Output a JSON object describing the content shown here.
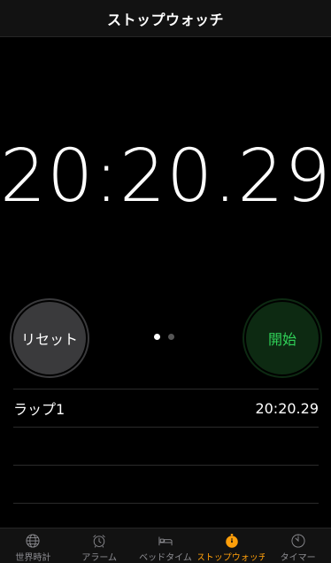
{
  "nav": {
    "title": "ストップウォッチ"
  },
  "timer": {
    "display": "20:20.29"
  },
  "buttons": {
    "reset_label": "リセット",
    "start_label": "開始"
  },
  "page_dots": {
    "count": 2,
    "active_index": 0
  },
  "laps": [
    {
      "label": "ラップ1",
      "time": "20:20.29"
    }
  ],
  "tabbar": {
    "active_index": 3,
    "items": [
      {
        "label": "世界時計",
        "icon": "globe-icon"
      },
      {
        "label": "アラーム",
        "icon": "alarm-clock-icon"
      },
      {
        "label": "ベッドタイム",
        "icon": "bed-icon"
      },
      {
        "label": "ストップウォッチ",
        "icon": "stopwatch-icon"
      },
      {
        "label": "タイマー",
        "icon": "timer-icon"
      }
    ]
  },
  "colors": {
    "accent": "#ff9f0a",
    "start_green": "#30d158",
    "start_bg": "#0d2a12",
    "reset_bg": "#3a3a3c",
    "inactive_tab": "#8e8e93"
  }
}
